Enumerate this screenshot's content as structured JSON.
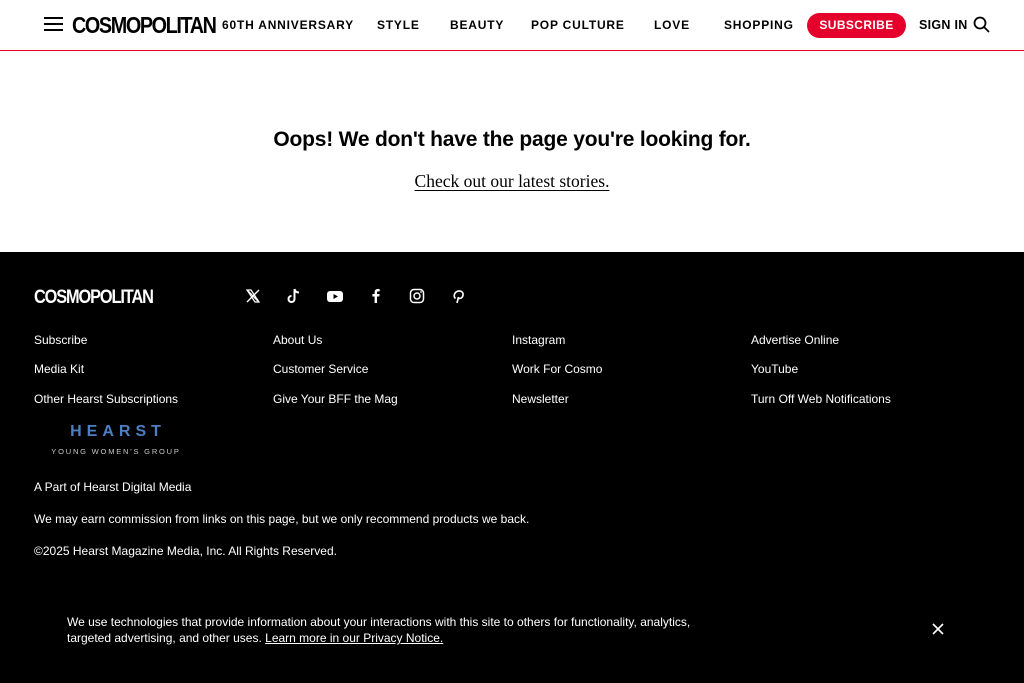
{
  "header": {
    "logo": "COSMOPOLITAN",
    "nav": [
      "60TH ANNIVERSARY",
      "STYLE",
      "BEAUTY",
      "POP CULTURE",
      "LOVE",
      "SHOPPING"
    ],
    "subscribe_label": "SUBSCRIBE",
    "signin_label": "SIGN IN",
    "accent_color": "#e4002b"
  },
  "main": {
    "heading": "Oops! We don't have the page you're looking for.",
    "link_text": "Check out our latest stories."
  },
  "footer": {
    "logo": "COSMOPOLITAN",
    "social_icons": [
      "x-icon",
      "tiktok-icon",
      "youtube-icon",
      "facebook-icon",
      "instagram-icon",
      "pinterest-icon"
    ],
    "columns": [
      [
        "Subscribe",
        "Media Kit",
        "Other Hearst Subscriptions"
      ],
      [
        "About Us",
        "Customer Service",
        "Give Your BFF the Mag"
      ],
      [
        "Instagram",
        "Work For Cosmo",
        "Newsletter"
      ],
      [
        "Advertise Online",
        "YouTube",
        "Turn Off Web Notifications"
      ]
    ],
    "hearst_logo": "HEARST",
    "hearst_sub": "YOUNG WOMEN'S GROUP",
    "hearst_color": "#4c7fc4",
    "part_of": "A Part of Hearst Digital Media",
    "commission": "We may earn commission from links on this page, but we only recommend products we back.",
    "copyright": "©2025 Hearst Magazine Media, Inc. All Rights Reserved."
  },
  "cookie": {
    "text": "We use technologies that provide information about your interactions with this site to others for functionality, analytics, targeted advertising, and other uses.",
    "link": "Learn more in our Privacy Notice."
  }
}
